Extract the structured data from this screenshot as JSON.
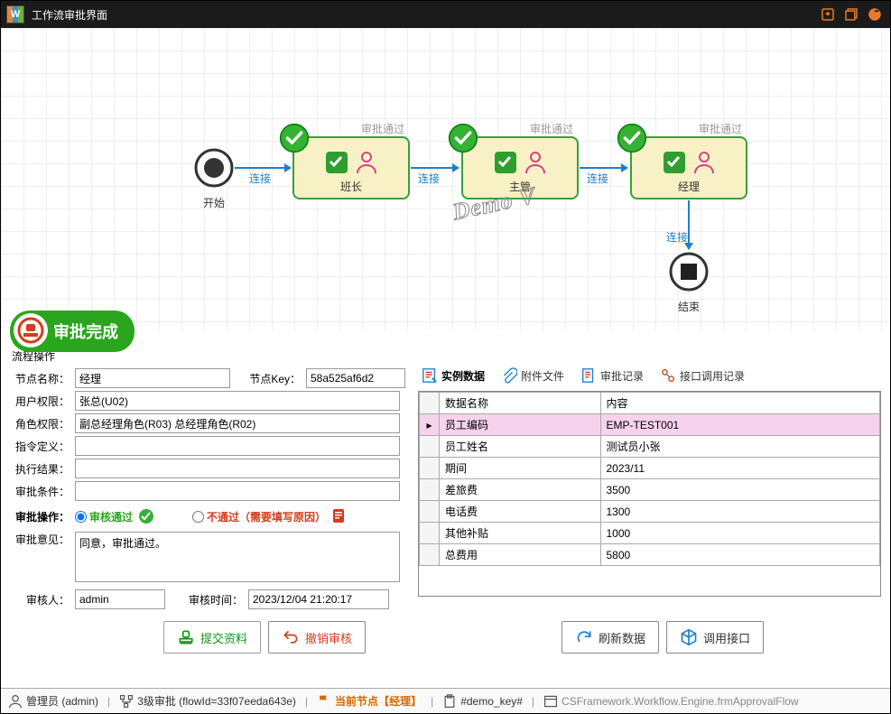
{
  "title": "工作流审批界面",
  "flow": {
    "start_label": "开始",
    "end_label": "结束",
    "conn_label": "连接",
    "pass_label": "审批通过",
    "nodes": [
      {
        "label": "班长"
      },
      {
        "label": "主管"
      },
      {
        "label": "经理"
      }
    ],
    "watermark": "Demo V"
  },
  "approve_done_label": "审批完成",
  "form": {
    "group_title": "流程操作",
    "fields": {
      "node_name": {
        "label": "节点名称：",
        "value": "经理"
      },
      "node_key": {
        "label": "节点Key：",
        "value": "58a525af6d2"
      },
      "user_perm": {
        "label": "用户权限：",
        "value": "张总(U02)"
      },
      "role_perm": {
        "label": "角色权限：",
        "value": "副总经理角色(R03) 总经理角色(R02)"
      },
      "cmd_def": {
        "label": "指令定义：",
        "value": ""
      },
      "exec_result": {
        "label": "执行结果：",
        "value": ""
      },
      "approve_cond": {
        "label": "审批条件：",
        "value": ""
      },
      "approve_op": {
        "label": "审批操作：",
        "pass": "审核通过",
        "fail": "不通过（需要填写原因）"
      },
      "opinion": {
        "label": "审批意见：",
        "value": "同意，审批通过。"
      },
      "auditor": {
        "label": "审核人：",
        "value": "admin"
      },
      "audit_time": {
        "label": "审核时间：",
        "value": "2023/12/04 21:20:17"
      }
    }
  },
  "tabs": {
    "t0": "实例数据",
    "t1": "附件文件",
    "t2": "审批记录",
    "t3": "接口调用记录"
  },
  "table": {
    "headers": {
      "h0": "数据名称",
      "h1": "内容"
    },
    "rows": [
      {
        "k": "员工编码",
        "v": "EMP-TEST001"
      },
      {
        "k": "员工姓名",
        "v": "测试员小张"
      },
      {
        "k": "期间",
        "v": "2023/11"
      },
      {
        "k": "差旅费",
        "v": "3500"
      },
      {
        "k": "电话费",
        "v": "1300"
      },
      {
        "k": "其他补贴",
        "v": "1000"
      },
      {
        "k": "总费用",
        "v": "5800"
      }
    ]
  },
  "buttons": {
    "submit": "提交资料",
    "revoke": "撤销审核",
    "refresh": "刷新数据",
    "call_api": "调用接口"
  },
  "status": {
    "user": "管理员 (admin)",
    "flow": "3级审批 (flowId=33f07eeda643e)",
    "current_node_prefix": "当前节点",
    "current_node": "【经理】",
    "demo_key": "#demo_key#",
    "form_class": "CSFramework.Workflow.Engine.frmApprovalFlow"
  }
}
